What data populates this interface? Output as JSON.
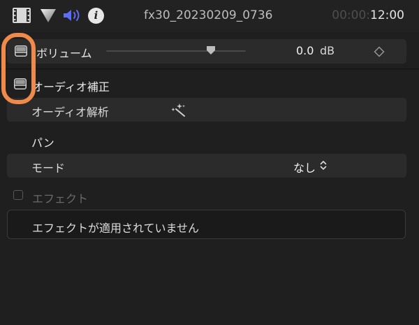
{
  "header": {
    "clip_title": "fx30_20230209_0736",
    "timecode_dim": "00:00:",
    "timecode_bright": "12:00",
    "icons": [
      "film-icon",
      "color-icon",
      "audio-icon",
      "info-icon"
    ],
    "info_glyph": "i",
    "accent_color": "#5b6cf5"
  },
  "volume": {
    "label": "ボリューム",
    "value": "0.0",
    "unit": "dB",
    "slider_level": 0.75
  },
  "audio_enhancements": {
    "title": "オーディオ補正",
    "analysis_label": "オーディオ解析"
  },
  "pan": {
    "title": "パン",
    "mode_label": "モード",
    "mode_value": "なし"
  },
  "effects": {
    "title": "エフェクト",
    "empty_message": "エフェクトが適用されていません"
  },
  "highlight_color": "#f08a4b"
}
